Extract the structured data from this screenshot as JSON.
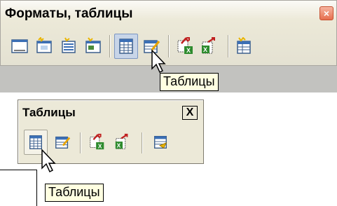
{
  "top_toolbar": {
    "title": "Форматы, таблицы",
    "buttons": [
      {
        "name": "format-page-icon"
      },
      {
        "name": "new-style-icon"
      },
      {
        "name": "format-list-icon"
      },
      {
        "name": "format-frame-icon"
      },
      {
        "name": "tables-icon",
        "active": true
      },
      {
        "name": "table-edit-icon"
      },
      {
        "name": "insert-excel-icon"
      },
      {
        "name": "excel-link-icon"
      },
      {
        "name": "wizard-table-icon"
      }
    ],
    "tooltip": "Таблицы",
    "close_color": "#e66e4e"
  },
  "small_toolbar": {
    "title": "Таблицы",
    "close_label": "X",
    "tooltip": "Таблицы"
  }
}
